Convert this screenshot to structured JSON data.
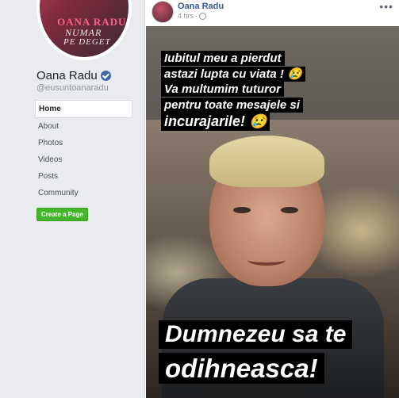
{
  "sidebar": {
    "avatar_text": [
      "OANA RADU",
      "NUMAR",
      "PE DEGET"
    ],
    "page_name": "Oana Radu",
    "handle": "@eusuntoanaradu",
    "nav": [
      {
        "label": "Home",
        "active": true
      },
      {
        "label": "About"
      },
      {
        "label": "Photos"
      },
      {
        "label": "Videos"
      },
      {
        "label": "Posts"
      },
      {
        "label": "Community"
      }
    ],
    "create_page_label": "Create a Page"
  },
  "post": {
    "author": "Oana Radu",
    "time": "4 hrs",
    "more_icon": "ellipsis-icon",
    "story_captions": [
      "Iubitul meu a pierdut",
      "astazi lupta cu viata ! 😢",
      "Va multumim tuturor",
      "pentru toate mesajele si",
      "incurajarile! 😢"
    ],
    "bottom_captions": [
      "Dumnezeu sa te",
      "odihneasca!"
    ]
  },
  "colors": {
    "link": "#365899",
    "create_button": "#42b72a",
    "verified": "#4267b2"
  }
}
